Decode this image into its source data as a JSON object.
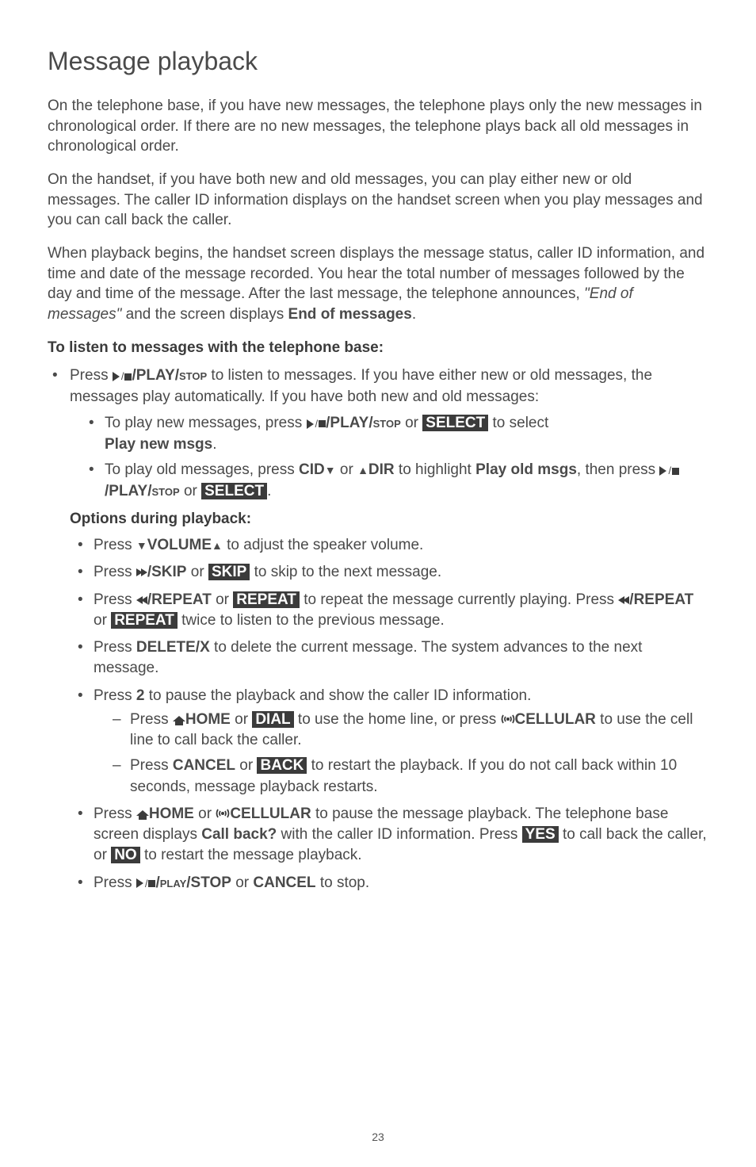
{
  "title": "Message playback",
  "para1": "On the telephone base, if you have new messages, the telephone plays only the new messages in chronological order. If there are no new messages, the telephone plays back all old messages in chronological order.",
  "para2": "On the handset, if you have both new and old messages, you can play either new or old messages. The caller ID information displays on the handset screen when you play messages and you can call back the caller.",
  "para3_a": "When playback begins, the handset screen displays the message status, caller ID information, and time and date of the message recorded. You hear the total number of messages followed by the day and time of the message. After the last message, the telephone announces, ",
  "para3_quote": "\"End of messages\"",
  "para3_b": " and the screen displays ",
  "para3_bold": "End of messages",
  "subhead1": "To listen to messages with the telephone base:",
  "b1a": "Press ",
  "b1b": "/PLAY/",
  "b1c": "stop",
  "b1d": " to listen to messages. If you have either new or old messages, the messages play automatically. If you have both new and old messages:",
  "b1_1a": "To play new messages, press ",
  "b1_1b": "/PLAY/",
  "b1_1c": "stop",
  "b1_1d": " or ",
  "b1_1_select": "SELECT",
  "b1_1e": " to select ",
  "b1_1f": "Play new msgs",
  "b1_2a": "To play old messages, press ",
  "b1_2_cid": "CID",
  "b1_2b": " or ",
  "b1_2_dir": "DIR",
  "b1_2c": " to highlight ",
  "b1_2d": "Play old msgs",
  "b1_2e": ", then press ",
  "b1_2f": "/PLAY/",
  "b1_2g": "stop",
  "b1_2h": " or ",
  "b1_2_select": "SELECT",
  "opthead": "Options during playback:",
  "o1a": "Press ",
  "o1_vol": "VOLUME",
  "o1b": " to adjust the speaker volume.",
  "o2a": "Press ",
  "o2_skip": "/SKIP",
  "o2b": " or ",
  "o2_inv": "SKIP",
  "o2c": " to skip to the next message.",
  "o3a": "Press ",
  "o3_rep": "/REPEAT",
  "o3b": " or ",
  "o3_inv": "REPEAT",
  "o3c": " to repeat the message currently playing. Press ",
  "o3d": "/REPEAT",
  "o3e": " or ",
  "o3_inv2": "REPEAT",
  "o3f": " twice to listen to the previous message.",
  "o4a": "Press ",
  "o4_del": "DELETE/X",
  "o4b": " to delete the current message. The system advances to the next message.",
  "o5a": "Press ",
  "o5_two": "2",
  "o5b": " to pause the playback and show the caller ID information.",
  "o5_1a": "Press ",
  "o5_1_home": "HOME",
  "o5_1b": " or ",
  "o5_1_dial": "DIAL",
  "o5_1c": " to use the home line, or press ",
  "o5_1_cell": "CELLULAR",
  "o5_1d": " to use the cell line to call back the caller.",
  "o5_2a": "Press ",
  "o5_2_cancel": "CANCEL",
  "o5_2b": " or ",
  "o5_2_back": "BACK",
  "o5_2c": " to restart the playback. If you do not call back within 10 seconds, message playback restarts.",
  "o6a": "Press ",
  "o6_home": "HOME",
  "o6b": " or ",
  "o6_cell": "CELLULAR",
  "o6c": " to pause the message playback. The telephone base screen displays ",
  "o6_cb": "Call back?",
  "o6d": " with the caller ID information. Press ",
  "o6_yes": "YES",
  "o6e": " to call back the caller, or ",
  "o6_no": "NO",
  "o6f": " to restart the message playback.",
  "o7a": "Press ",
  "o7b": "/",
  "o7c": "play",
  "o7d": "/STOP",
  "o7e": " or ",
  "o7_cancel": "CANCEL",
  "o7f": " to stop.",
  "pagenum": "23"
}
